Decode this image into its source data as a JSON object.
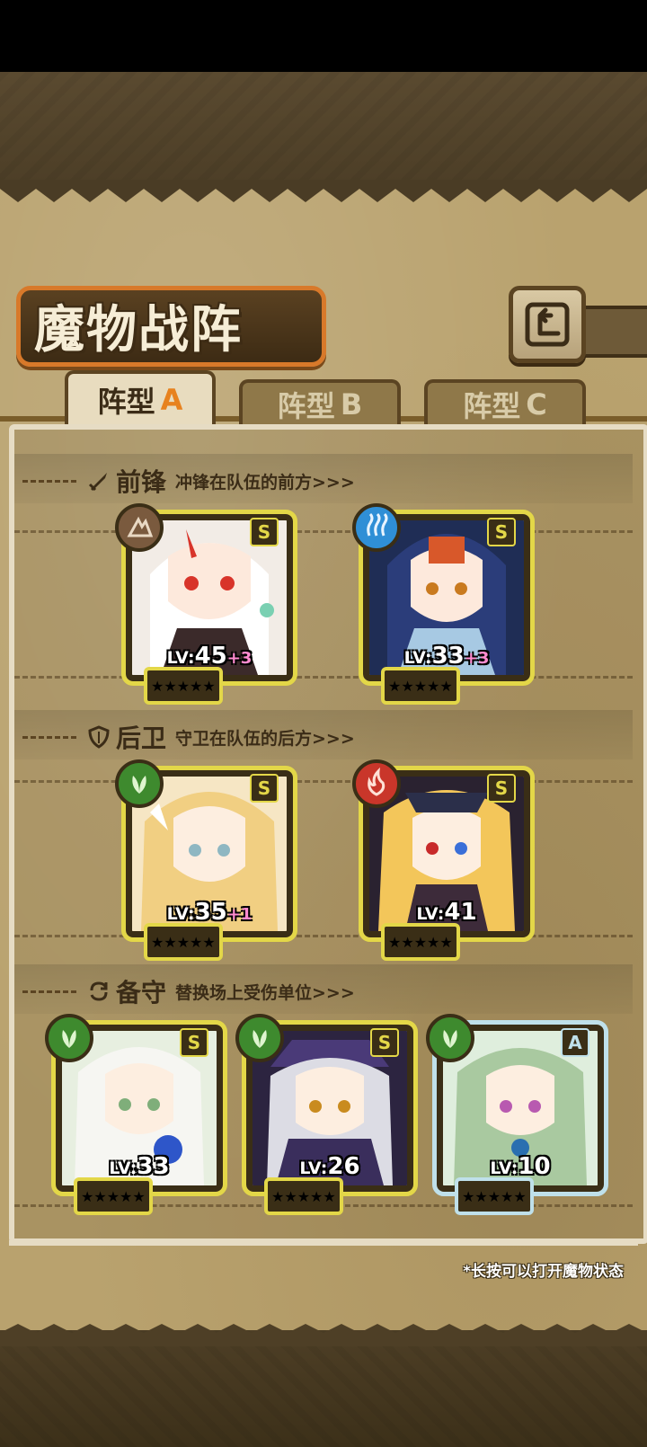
{
  "title": "魔物战阵",
  "tabs": [
    {
      "label": "阵型",
      "letter": "A",
      "active": true
    },
    {
      "label": "阵型",
      "letter": "B",
      "active": false
    },
    {
      "label": "阵型",
      "letter": "C",
      "active": false
    }
  ],
  "sections": {
    "front": {
      "title": "前锋",
      "desc": "冲锋在队伍的前方>>>"
    },
    "rear": {
      "title": "后卫",
      "desc": "守卫在队伍的后方>>>"
    },
    "reserve": {
      "title": "备守",
      "desc": "替换场上受伤单位>>>"
    }
  },
  "units": {
    "front": [
      {
        "lv_tag": "LV:",
        "level": "45",
        "plus": "+3",
        "rank": "S",
        "element": "earth",
        "element_color": "#7a5a3e",
        "stars": "★★★★★"
      },
      {
        "lv_tag": "LV:",
        "level": "33",
        "plus": "+3",
        "rank": "S",
        "element": "water",
        "element_color": "#2f8fd6",
        "stars": "★★★★★"
      }
    ],
    "rear": [
      {
        "lv_tag": "LV:",
        "level": "35",
        "plus": "+1",
        "rank": "S",
        "element": "wood",
        "element_color": "#3e8a2e",
        "stars": "★★★★★"
      },
      {
        "lv_tag": "LV:",
        "level": "41",
        "plus": "",
        "rank": "S",
        "element": "fire",
        "element_color": "#c9362a",
        "stars": "★★★★★"
      }
    ],
    "reserve": [
      {
        "lv_tag": "LV:",
        "level": "33",
        "plus": "",
        "rank": "S",
        "element": "wood",
        "element_color": "#3e8a2e",
        "stars": "★★★★★"
      },
      {
        "lv_tag": "LV:",
        "level": "26",
        "plus": "",
        "rank": "S",
        "element": "wood",
        "element_color": "#3e8a2e",
        "stars": "★★★★★"
      },
      {
        "lv_tag": "LV:",
        "level": "10",
        "plus": "",
        "rank": "A",
        "element": "wood",
        "element_color": "#3e8a2e",
        "stars": "★★★★★"
      }
    ]
  },
  "footnote": "*长按可以打开魔物状态",
  "colors": {
    "accent": "#e7821f",
    "frame_s": "#e3d748",
    "frame_a": "#bfe0ea",
    "star": "#ffcf2e"
  }
}
